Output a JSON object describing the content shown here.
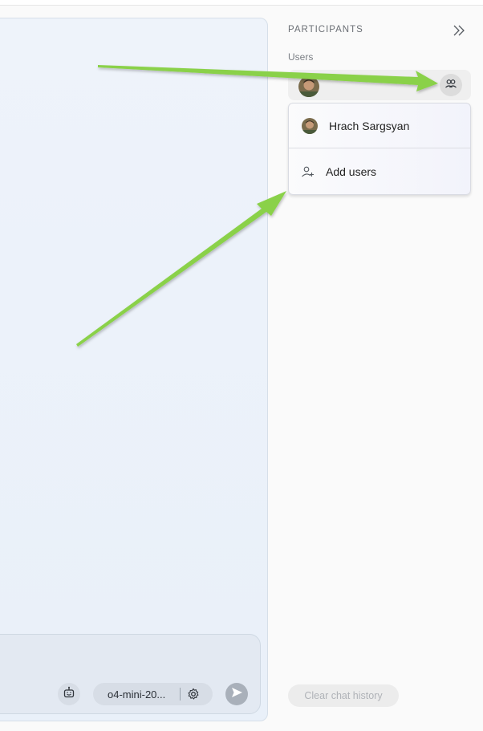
{
  "right_panel": {
    "title": "PARTICIPANTS",
    "section_label": "Users",
    "icons": {
      "collapse": "chevrons-right-icon",
      "users_toggle": "users-icon"
    }
  },
  "participants_dropdown": {
    "items": [
      {
        "label": "Hrach Sargsyan",
        "icon": "avatar"
      },
      {
        "label": "Add users",
        "icon": "add-user-icon"
      }
    ]
  },
  "composer": {
    "model_label": "o4-mini-20...",
    "icons": {
      "bot": "robot-icon",
      "settings": "gear-icon",
      "send": "send-icon"
    }
  },
  "footer": {
    "clear_button_label": "Clear chat history"
  },
  "colors": {
    "annotation_arrow": "#8ad14a",
    "chat_background": "#eaf0f8",
    "panel_background": "#fafafa"
  }
}
